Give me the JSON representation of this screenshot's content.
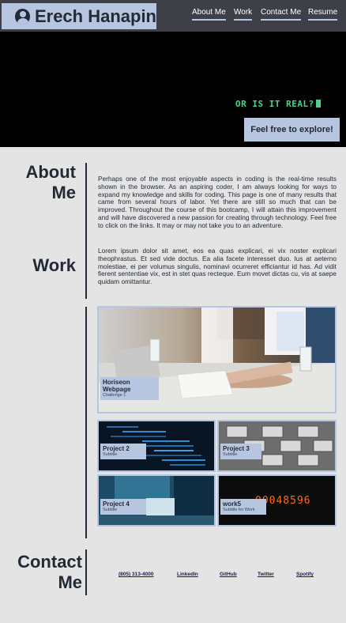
{
  "header": {
    "name": "Erech Hanapin",
    "nav": [
      "About Me",
      "Work",
      "Contact Me",
      "Resume"
    ]
  },
  "hero": {
    "terminal_text": "OR IS IT REAL?",
    "explore_button": "Feel free to explore!"
  },
  "about": {
    "title": "About Me",
    "paragraphs": [
      "Perhaps one of the most enjoyable aspects in coding is the real-time results shown in the browser. As an aspiring coder, I am always looking for ways to expand my knowledge and skills for coding. This page is one of many results that came from several hours of labor. Yet there are still so much that can be improved. Throughout the course of this bootcamp, I will attain this improvement and will have discovered a new passion for creating through technology. Feel free to click on the links. It may or may not take you to an adventure.",
      "Lorem ipsum dolor sit amet, eos ea quas explicari, ei vix noster explicari theophrastus. Et sed vide doctus. Ea alia facete interesset duo. Ius at aeterno molestiae, ei per volumus singulis, nominavi ocurreret efficiantur id has. Ad vidit fierent sententiae vix, est in stet quas recteque. Eum movet dictas cu, vis at saepe quidam omittantur."
    ]
  },
  "work": {
    "title": "Work",
    "projects": [
      {
        "title": "Horiseon Webpage",
        "subtitle": "Challenge 1"
      },
      {
        "title": "Project 2",
        "subtitle": "Subtitle"
      },
      {
        "title": "Project 3",
        "subtitle": "Subtitle"
      },
      {
        "title": "Project 4",
        "subtitle": "Subtitle"
      },
      {
        "title": "work5",
        "subtitle": "Subtitle for Work"
      }
    ],
    "digits": "00048596"
  },
  "contact": {
    "title": "Contact Me",
    "links": [
      "(805) 313-4000",
      "LinkedIn",
      "GitHub",
      "Twitter",
      "Spotify"
    ]
  },
  "colors": {
    "accent": "#b7c6e0",
    "dark": "#232a35",
    "header_bg": "#3f3f48",
    "page_bg": "#e4e4e4",
    "terminal_green": "#4fd189",
    "nixie": "#ff6a1a"
  }
}
